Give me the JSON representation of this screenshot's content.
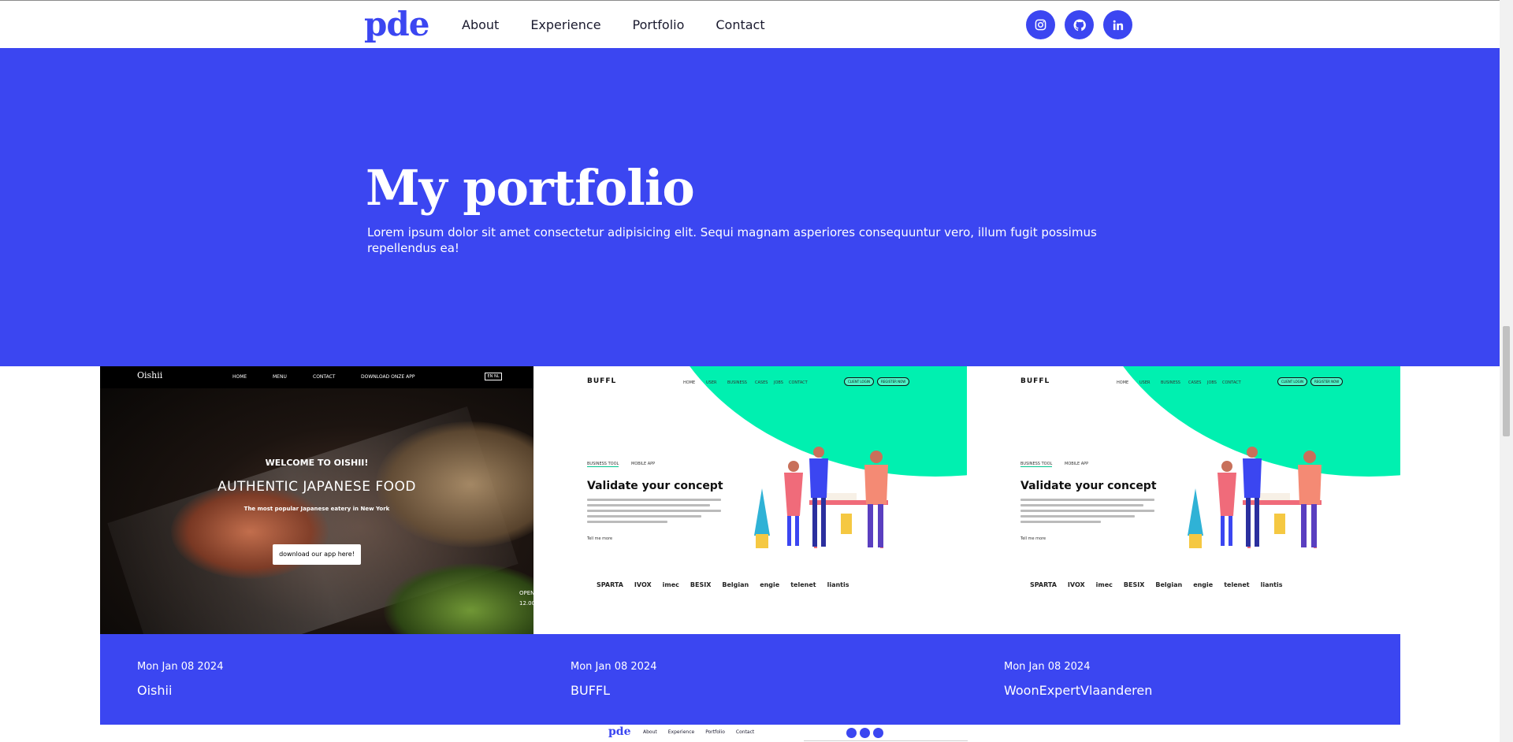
{
  "header": {
    "logo": "pde",
    "nav": [
      "About",
      "Experience",
      "Portfolio",
      "Contact"
    ],
    "socials": [
      "instagram-icon",
      "github-icon",
      "linkedin-icon"
    ]
  },
  "hero": {
    "title": "My portfolio",
    "description": "Lorem ipsum dolor sit amet consectetur adipisicing elit. Sequi magnam asperiores consequuntur vero, illum fugit possimus repellendus ea!"
  },
  "colors": {
    "accent": "#3b46f1",
    "buffl_green": "#00f0b0"
  },
  "projects": [
    {
      "date": "Mon Jan 08 2024",
      "name": "Oishii",
      "preview": {
        "logo": "Oishii",
        "nav": [
          "HOME",
          "MENU",
          "CONTACT",
          "DOWNLOAD ONZE APP"
        ],
        "lang": "EN NL",
        "welcome": "WELCOME TO OISHII!",
        "headline": "AUTHENTIC JAPANESE FOOD",
        "subline": "The most popular Japanese eatery in New York",
        "button": "download our app here!",
        "open": "OPEN",
        "hours": "12.00"
      }
    },
    {
      "date": "Mon Jan 08 2024",
      "name": "BUFFL",
      "preview": {
        "logo": "BUFFL",
        "nav": [
          "HOME",
          "USER",
          "BUSINESS",
          "CASES",
          "JOBS",
          "CONTACT"
        ],
        "pills": [
          "CLIENT LOGIN",
          "REGISTER NOW"
        ],
        "tabs": [
          "BUSINESS TOOL",
          "MOBILE APP"
        ],
        "title": "Validate your concept",
        "link": "Tell me more",
        "clients": [
          "SPARTA",
          "IVOX",
          "imec",
          "BESIX",
          "Belgian",
          "engie",
          "telenet",
          "liantis"
        ]
      }
    },
    {
      "date": "Mon Jan 08 2024",
      "name": "WoonExpertVlaanderen",
      "preview": {
        "logo": "BUFFL",
        "nav": [
          "HOME",
          "USER",
          "BUSINESS",
          "CASES",
          "JOBS",
          "CONTACT"
        ],
        "pills": [
          "CLIENT LOGIN",
          "REGISTER NOW"
        ],
        "tabs": [
          "BUSINESS TOOL",
          "MOBILE APP"
        ],
        "title": "Validate your concept",
        "link": "Tell me more",
        "clients": [
          "SPARTA",
          "IVOX",
          "imec",
          "BESIX",
          "Belgian",
          "engie",
          "telenet",
          "liantis"
        ]
      }
    }
  ],
  "footer": {
    "logo": "pde",
    "nav": [
      "About",
      "Experience",
      "Portfolio",
      "Contact"
    ]
  }
}
